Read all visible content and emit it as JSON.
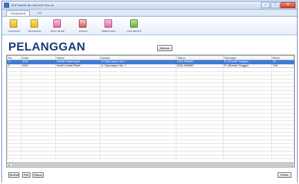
{
  "window": {
    "title": "SOFTWARE BILLING AIR PDA Uk",
    "min_glyph": "–",
    "max_glyph": "□",
    "close_glyph": "✕"
  },
  "ribbon": {
    "tabs": [
      {
        "label": "TRANSAKSI",
        "active": true
      },
      {
        "label": "Ctrl",
        "active": false
      }
    ],
    "buttons": [
      {
        "label": "GOLONGAN",
        "icon": "folder-icon"
      },
      {
        "label": "PELANGGAN",
        "icon": "folder-icon"
      },
      {
        "label": "INPUT METER",
        "icon": "document-icon"
      },
      {
        "label": "TAGIHAN",
        "icon": "document-icon"
      },
      {
        "label": "PEMBAYARAN",
        "icon": "document-icon"
      },
      {
        "label": "DATA REPORT",
        "icon": "chart-icon"
      }
    ]
  },
  "page": {
    "title": "PELANGGAN",
    "refresh_label": "Refresh"
  },
  "table": {
    "columns": [
      "No",
      "Kode",
      "Nama",
      "Alamat",
      "Telpon",
      "Golongan",
      "Meter"
    ],
    "rows": [
      {
        "no": "1",
        "kode": "1001",
        "nama": "Novita Pujianingsih",
        "alamat": "Jl. Diponegoro No.1",
        "telpon": "0341-808080",
        "golongan": "R. (Rumah Tangga)",
        "meter": "70",
        "selected": true
      },
      {
        "no": "2",
        "kode": "1001",
        "nama": "Indah Lestari Rismi",
        "alamat": "Jl. Diponegoro No. 1",
        "telpon": "0341-808080",
        "golongan": "R. (Rumah Tangga)",
        "meter": "108",
        "selected": false
      }
    ]
  },
  "actions": {
    "tambah_label": "Tambah",
    "edit_label": "Edit",
    "hapus_label": "Hapus",
    "keluar_label": "Keluar"
  },
  "colors": {
    "title": "#1b3a7a",
    "selection": "#3f7bd6"
  }
}
